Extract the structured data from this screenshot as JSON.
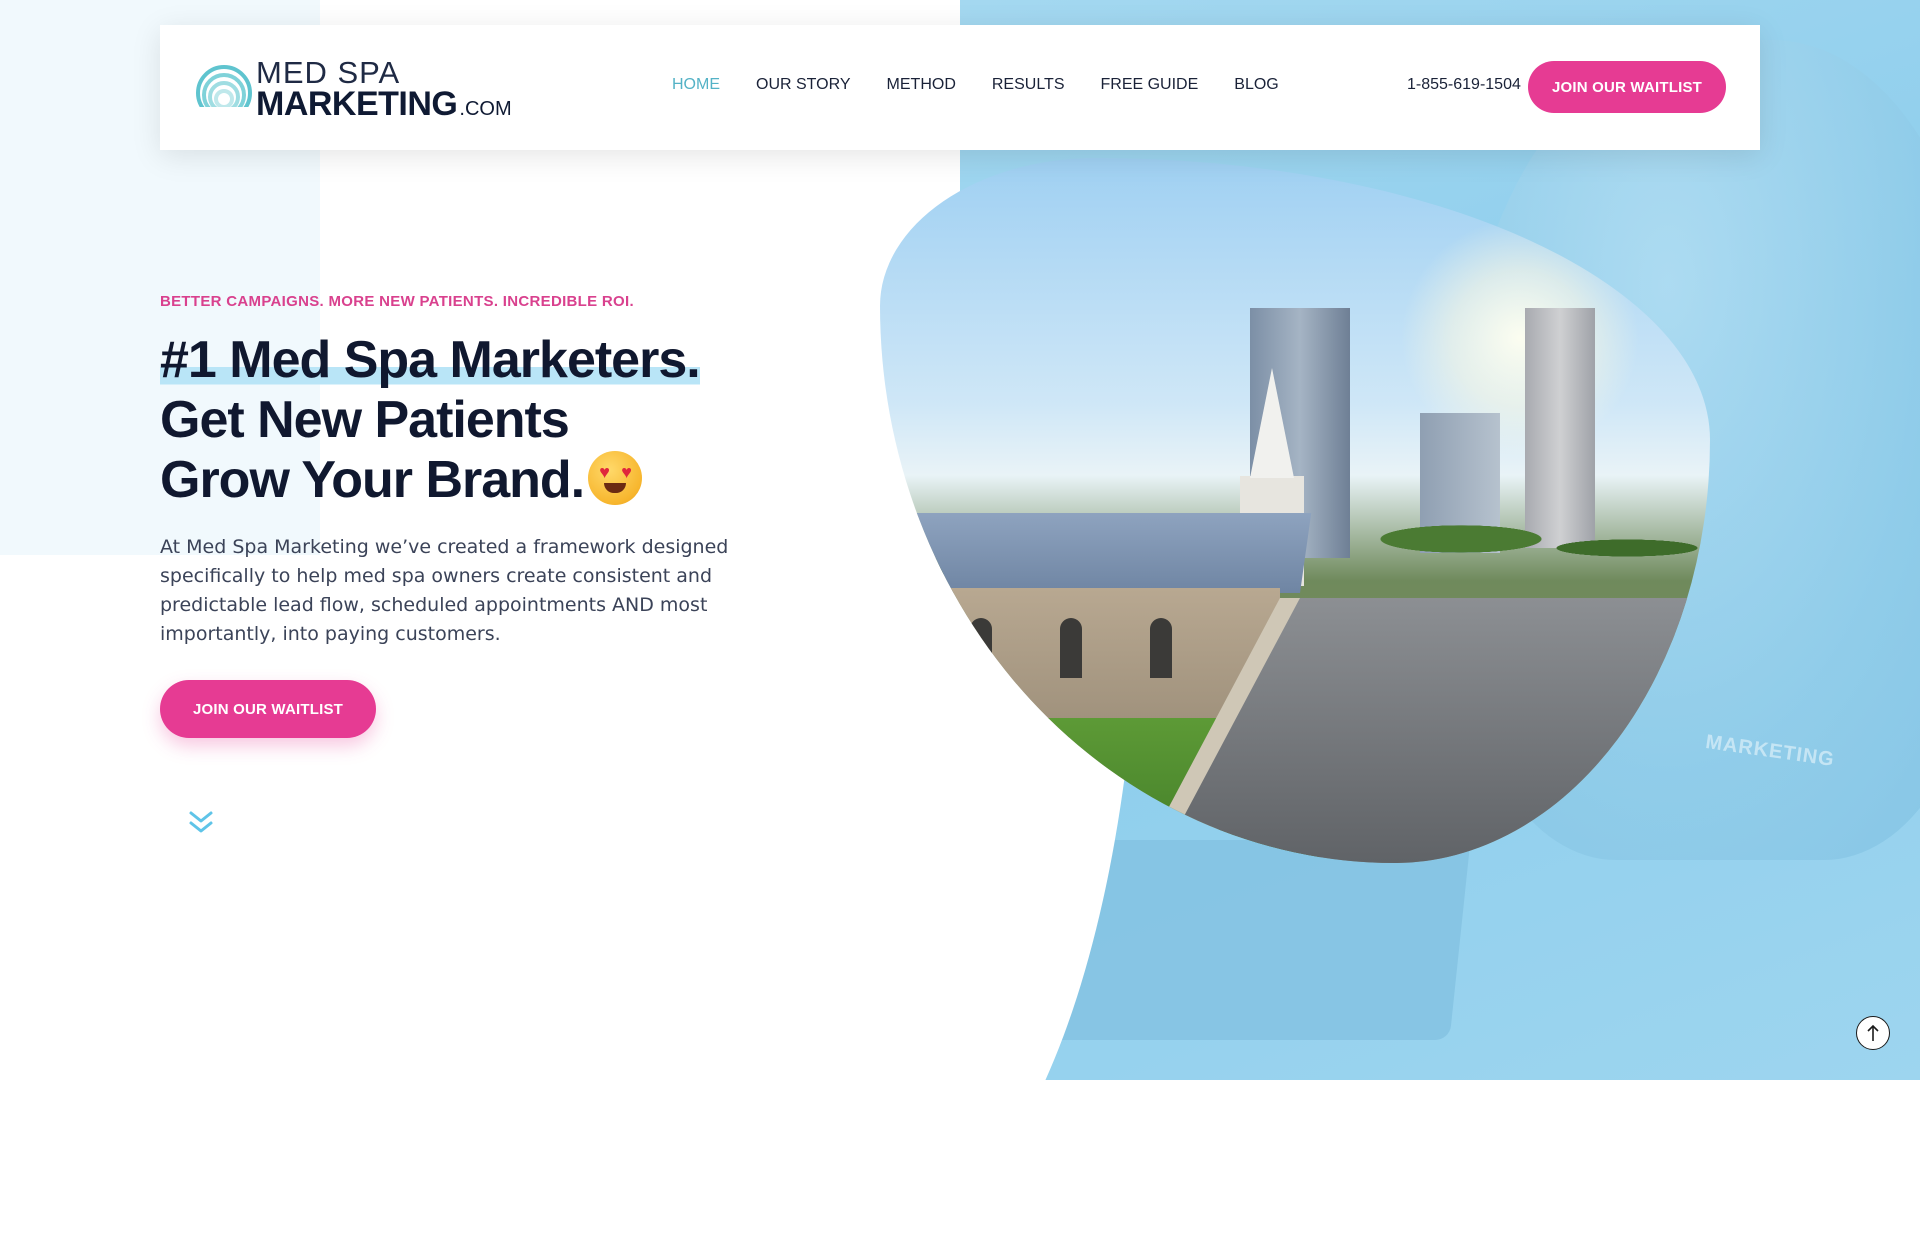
{
  "header": {
    "logo": {
      "line1": "MED SPA",
      "line2": "MARKETING",
      "suffix": ".COM"
    },
    "nav": [
      {
        "label": "HOME",
        "active": true
      },
      {
        "label": "OUR STORY",
        "active": false
      },
      {
        "label": "METHOD",
        "active": false
      },
      {
        "label": "RESULTS",
        "active": false
      },
      {
        "label": "FREE GUIDE",
        "active": false
      },
      {
        "label": "BLOG",
        "active": false
      }
    ],
    "phone": "1-855-619-1504",
    "cta_label": "JOIN OUR WAITLIST"
  },
  "hero": {
    "tagline": "BETTER CAMPAIGNS. MORE NEW PATIENTS. INCREDIBLE ROI.",
    "headline_line1": "#1 Med Spa Marketers.",
    "headline_line2": "Get New Patients",
    "headline_line3": "Grow Your Brand.",
    "body": "At Med Spa Marketing we’ve created a framework designed specifically to help med spa owners create consistent and predictable lead flow, scheduled appointments AND most importantly, into paying  customers.",
    "cta_label": "JOIN OUR WAITLIST"
  },
  "background": {
    "brand_mark": "MARKETING"
  },
  "icons": {
    "logo_mark": "rainbow-arc-icon",
    "emoji": "heart-eyes-emoji-icon",
    "scroll_down": "double-chevron-down-icon",
    "scroll_top": "arrow-up-icon"
  },
  "colors": {
    "accent_pink": "#e63b93",
    "tagline_pink": "#d9418e",
    "nav_active": "#54b2c6",
    "highlight_blue": "#b9e5f7",
    "heading_navy": "#10182f",
    "bg_blue": "#9dd5ef"
  }
}
